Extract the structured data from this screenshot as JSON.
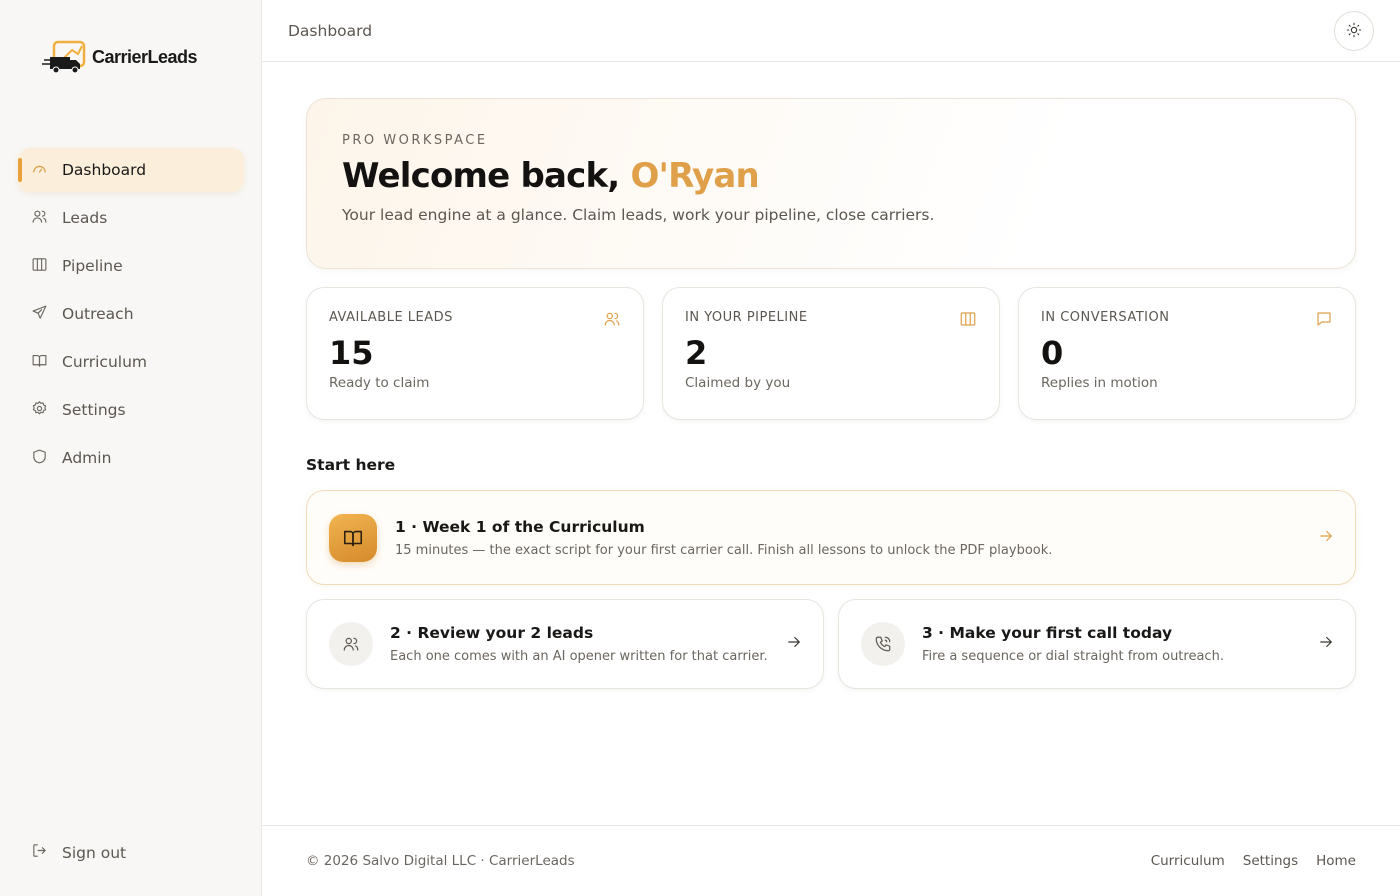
{
  "brand": {
    "name": "CarrierLeads"
  },
  "sidebar": {
    "items": [
      {
        "label": "Dashboard",
        "icon": "gauge-icon",
        "active": true
      },
      {
        "label": "Leads",
        "icon": "users-icon"
      },
      {
        "label": "Pipeline",
        "icon": "columns-icon"
      },
      {
        "label": "Outreach",
        "icon": "send-icon"
      },
      {
        "label": "Curriculum",
        "icon": "book-icon"
      },
      {
        "label": "Settings",
        "icon": "gear-icon"
      },
      {
        "label": "Admin",
        "icon": "shield-icon"
      }
    ],
    "signout_label": "Sign out"
  },
  "header": {
    "title": "Dashboard",
    "theme_icon": "sun-icon"
  },
  "hero": {
    "eyebrow": "PRO WORKSPACE",
    "greeting": "Welcome back,",
    "name": "O'Ryan",
    "subtitle": "Your lead engine at a glance. Claim leads, work your pipeline, close carriers."
  },
  "stats": [
    {
      "label": "AVAILABLE LEADS",
      "value": "15",
      "sub": "Ready to claim",
      "icon": "users-icon"
    },
    {
      "label": "IN YOUR PIPELINE",
      "value": "2",
      "sub": "Claimed by you",
      "icon": "columns-icon"
    },
    {
      "label": "IN CONVERSATION",
      "value": "0",
      "sub": "Replies in motion",
      "icon": "message-icon"
    }
  ],
  "start_here": {
    "title": "Start here",
    "steps": [
      {
        "title": "1 · Week 1 of the Curriculum",
        "desc": "15 minutes — the exact script for your first carrier call. Finish all lessons to unlock the PDF playbook.",
        "icon": "book-icon"
      },
      {
        "title": "2 · Review your 2 leads",
        "desc": "Each one comes with an AI opener written for that carrier.",
        "icon": "users-icon"
      },
      {
        "title": "3 · Make your first call today",
        "desc": "Fire a sequence or dial straight from outreach.",
        "icon": "phone-icon"
      }
    ]
  },
  "footer": {
    "copyright": "© 2026 Salvo Digital LLC · CarrierLeads",
    "links": [
      "Curriculum",
      "Settings",
      "Home"
    ]
  },
  "colors": {
    "accent": "#e0a04a",
    "active_bg": "#fbefdc"
  }
}
